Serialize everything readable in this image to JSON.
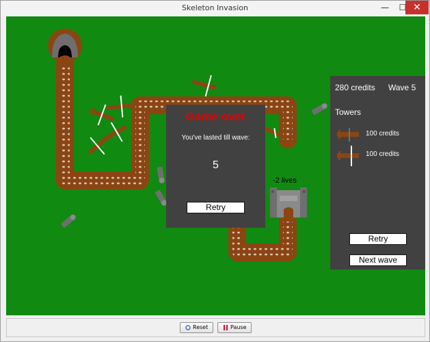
{
  "window": {
    "title": "Skeleton Invasion",
    "minimize_glyph": "—",
    "maximize_glyph": "☐",
    "close_glyph": "✕"
  },
  "game_over": {
    "title": "Game over",
    "message": "You've lasted till wave:",
    "wave_reached": "5",
    "retry_label": "Retry"
  },
  "hud": {
    "credits": "280 credits",
    "wave": "Wave 5",
    "lives": "-2 lives"
  },
  "tower_shop": {
    "heading": "Towers",
    "towers": [
      {
        "icon": "crossbow-tower-icon",
        "price": "100 credits"
      },
      {
        "icon": "lightning-crossbow-tower-icon",
        "price": "100 credits"
      }
    ],
    "retry_label": "Retry",
    "next_wave_label": "Next wave"
  },
  "controls": {
    "reset_label": "Reset",
    "pause_label": "Pause"
  },
  "colors": {
    "grass": "#108a10",
    "path": "#8b4513",
    "panel": "#414141",
    "game_over_text": "#e60000",
    "close_button": "#c7312b"
  }
}
